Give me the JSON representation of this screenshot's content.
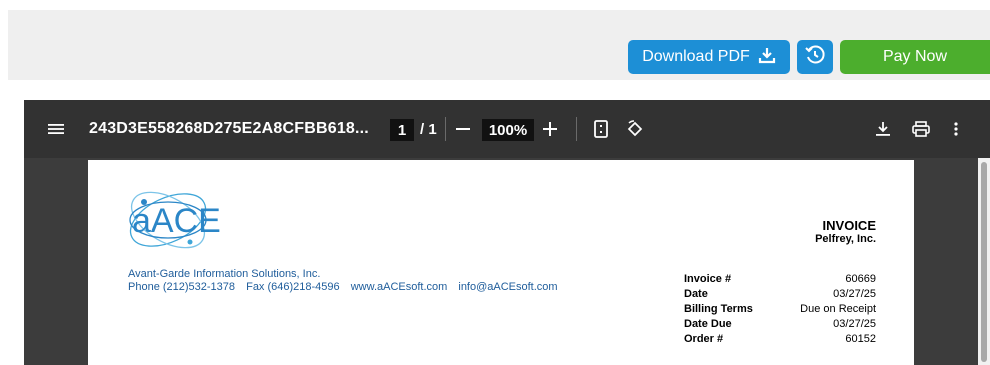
{
  "actions": {
    "download_label": "Download PDF",
    "pay_label": "Pay Now"
  },
  "viewer": {
    "filename": "243D3E558268D275E2A8CFBB618...",
    "current_page": "1",
    "page_separator": "/",
    "total_pages": "1",
    "zoom": "100%"
  },
  "document": {
    "title": "INVOICE",
    "customer": "Pelfrey, Inc.",
    "logo_text": "aACE",
    "company_name": "Avant-Garde Information Solutions, Inc.",
    "phone": "Phone (212)532-1378",
    "fax": "Fax (646)218-4596",
    "website": "www.aACEsoft.com",
    "email": "info@aACEsoft.com",
    "fields": [
      {
        "label": "Invoice #",
        "value": "60669"
      },
      {
        "label": "Date",
        "value": "03/27/25"
      },
      {
        "label": "Billing Terms",
        "value": "Due on Receipt"
      },
      {
        "label": "Date Due",
        "value": "03/27/25"
      },
      {
        "label": "Order #",
        "value": "60152"
      }
    ]
  },
  "colors": {
    "primary_blue": "#1d8fd6",
    "pay_green": "#4cae2d",
    "viewer_toolbar": "#323232"
  }
}
